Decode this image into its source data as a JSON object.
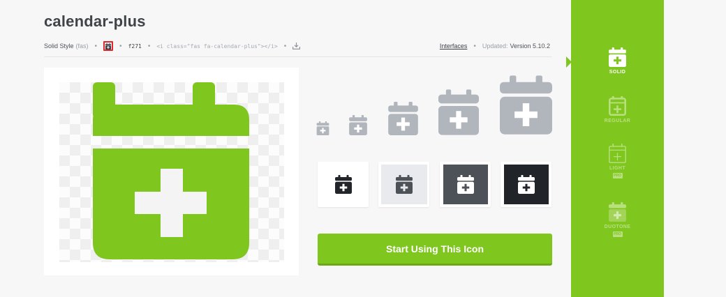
{
  "icon": {
    "name": "calendar-plus",
    "style_label": "Solid Style",
    "style_prefix": "(fas)",
    "unicode": "f271",
    "code_snippet": "<i class=\"fas fa-calendar-plus\"></i>",
    "link_label": "Interfaces",
    "updated_label": "Updated:",
    "version": "Version 5.10.2"
  },
  "actions": {
    "cta_label": "Start Using This Icon"
  },
  "sidebar": {
    "styles": [
      {
        "label": "SOLID",
        "active": true,
        "pro": false
      },
      {
        "label": "REGULAR",
        "active": false,
        "pro": false
      },
      {
        "label": "LIGHT",
        "active": false,
        "pro": true,
        "pro_label": "PRO"
      },
      {
        "label": "DUOTONE",
        "active": false,
        "pro": true,
        "pro_label": "PRO"
      }
    ]
  },
  "colors": {
    "brand_green": "#7fc61f",
    "icon_gray": "#b1b6bd",
    "highlight_red": "#e3262b"
  },
  "icon_names": [
    "calendar-plus-icon",
    "download-icon"
  ]
}
